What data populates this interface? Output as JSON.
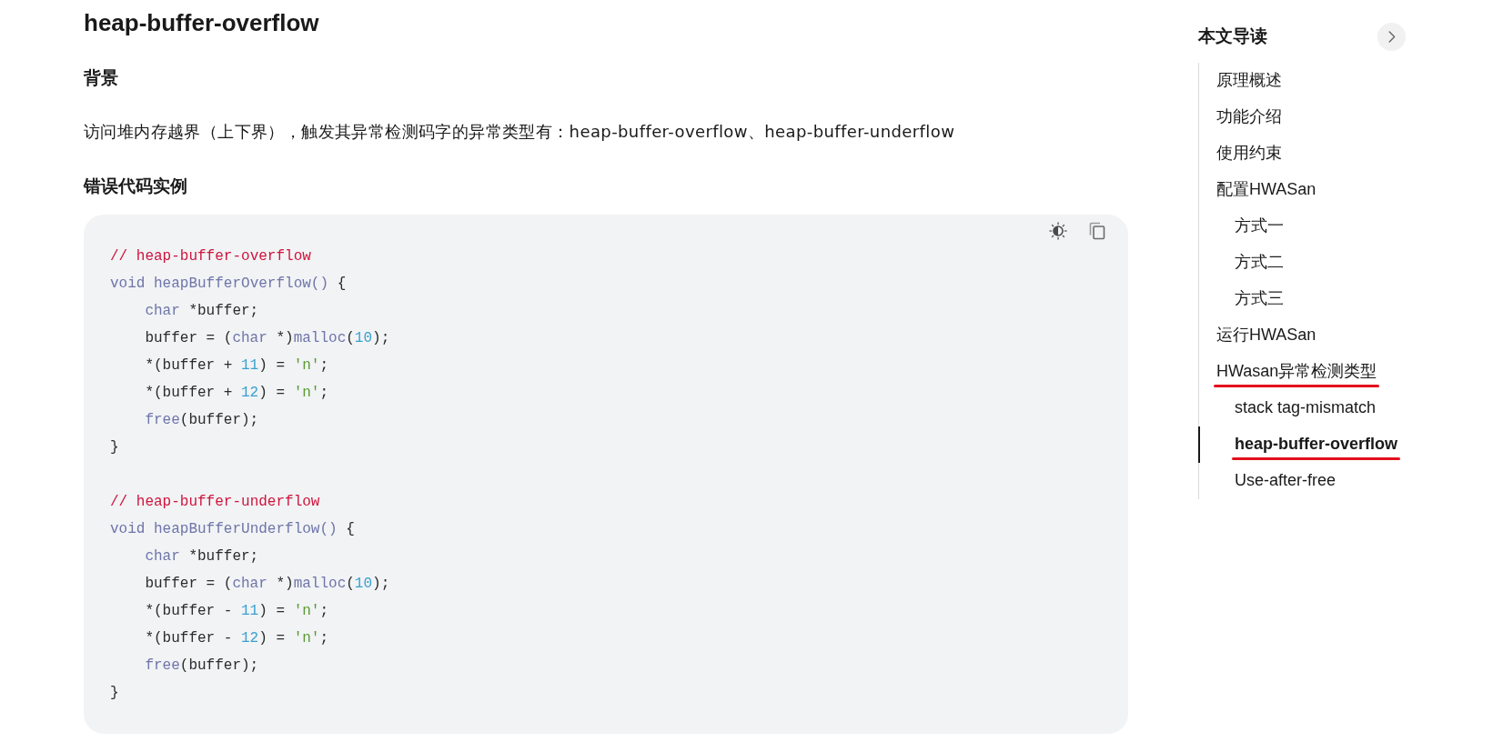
{
  "article": {
    "title": "heap-buffer-overflow",
    "background_heading": "背景",
    "background_text": "访问堆内存越界（上下界），触发其异常检测码字的异常类型有：heap-buffer-overflow、heap-buffer-underflow",
    "example_heading": "错误代码实例"
  },
  "code": {
    "snippets": [
      {
        "lines": [
          {
            "indented": false,
            "tokens": [
              {
                "kind": "comment",
                "text": "// heap-buffer-overflow"
              }
            ]
          },
          {
            "indented": false,
            "tokens": [
              {
                "kind": "keyword",
                "text": "void heapBufferOverflow()"
              },
              {
                "kind": "plain",
                "text": " {"
              }
            ]
          },
          {
            "indented": true,
            "tokens": [
              {
                "kind": "keyword",
                "text": "char"
              },
              {
                "kind": "plain",
                "text": " *buffer;"
              }
            ]
          },
          {
            "indented": true,
            "tokens": [
              {
                "kind": "plain",
                "text": "buffer = ("
              },
              {
                "kind": "keyword",
                "text": "char"
              },
              {
                "kind": "plain",
                "text": " *)"
              },
              {
                "kind": "keyword",
                "text": "malloc"
              },
              {
                "kind": "plain",
                "text": "("
              },
              {
                "kind": "number",
                "text": "10"
              },
              {
                "kind": "plain",
                "text": ");"
              }
            ]
          },
          {
            "indented": true,
            "tokens": [
              {
                "kind": "plain",
                "text": "*(buffer + "
              },
              {
                "kind": "number",
                "text": "11"
              },
              {
                "kind": "plain",
                "text": ") = "
              },
              {
                "kind": "string",
                "text": "'n'"
              },
              {
                "kind": "plain",
                "text": ";"
              }
            ]
          },
          {
            "indented": true,
            "tokens": [
              {
                "kind": "plain",
                "text": "*(buffer + "
              },
              {
                "kind": "number",
                "text": "12"
              },
              {
                "kind": "plain",
                "text": ") = "
              },
              {
                "kind": "string",
                "text": "'n'"
              },
              {
                "kind": "plain",
                "text": ";"
              }
            ]
          },
          {
            "indented": true,
            "tokens": [
              {
                "kind": "keyword",
                "text": "free"
              },
              {
                "kind": "plain",
                "text": "(buffer);"
              }
            ]
          },
          {
            "indented": false,
            "tokens": [
              {
                "kind": "plain",
                "text": "}"
              }
            ]
          }
        ]
      },
      {
        "lines": [
          {
            "indented": false,
            "tokens": [
              {
                "kind": "comment",
                "text": "// heap-buffer-underflow"
              }
            ]
          },
          {
            "indented": false,
            "tokens": [
              {
                "kind": "keyword",
                "text": "void heapBufferUnderflow()"
              },
              {
                "kind": "plain",
                "text": " {"
              }
            ]
          },
          {
            "indented": true,
            "tokens": [
              {
                "kind": "keyword",
                "text": "char"
              },
              {
                "kind": "plain",
                "text": " *buffer;"
              }
            ]
          },
          {
            "indented": true,
            "tokens": [
              {
                "kind": "plain",
                "text": "buffer = ("
              },
              {
                "kind": "keyword",
                "text": "char"
              },
              {
                "kind": "plain",
                "text": " *)"
              },
              {
                "kind": "keyword",
                "text": "malloc"
              },
              {
                "kind": "plain",
                "text": "("
              },
              {
                "kind": "number",
                "text": "10"
              },
              {
                "kind": "plain",
                "text": ");"
              }
            ]
          },
          {
            "indented": true,
            "tokens": [
              {
                "kind": "plain",
                "text": "*(buffer - "
              },
              {
                "kind": "number",
                "text": "11"
              },
              {
                "kind": "plain",
                "text": ") = "
              },
              {
                "kind": "string",
                "text": "'n'"
              },
              {
                "kind": "plain",
                "text": ";"
              }
            ]
          },
          {
            "indented": true,
            "tokens": [
              {
                "kind": "plain",
                "text": "*(buffer - "
              },
              {
                "kind": "number",
                "text": "12"
              },
              {
                "kind": "plain",
                "text": ") = "
              },
              {
                "kind": "string",
                "text": "'n'"
              },
              {
                "kind": "plain",
                "text": ";"
              }
            ]
          },
          {
            "indented": true,
            "tokens": [
              {
                "kind": "keyword",
                "text": "free"
              },
              {
                "kind": "plain",
                "text": "(buffer);"
              }
            ]
          },
          {
            "indented": false,
            "tokens": [
              {
                "kind": "plain",
                "text": "}"
              }
            ]
          }
        ]
      }
    ]
  },
  "toc": {
    "title": "本文导读",
    "items": [
      {
        "label": "原理概述",
        "selected": false,
        "underlined": false
      },
      {
        "label": "功能介绍",
        "selected": false,
        "underlined": false
      },
      {
        "label": "使用约束",
        "selected": false,
        "underlined": false
      },
      {
        "label": "配置HWASan",
        "selected": false,
        "underlined": false,
        "children": [
          {
            "label": "方式一",
            "selected": false,
            "underlined": false
          },
          {
            "label": "方式二",
            "selected": false,
            "underlined": false
          },
          {
            "label": "方式三",
            "selected": false,
            "underlined": false
          }
        ]
      },
      {
        "label": "运行HWASan",
        "selected": false,
        "underlined": false
      },
      {
        "label": "HWasan异常检测类型",
        "selected": false,
        "underlined": true,
        "children": [
          {
            "label": "stack tag-mismatch",
            "selected": false,
            "underlined": false
          },
          {
            "label": "heap-buffer-overflow",
            "selected": true,
            "underlined": true
          },
          {
            "label": "Use-after-free",
            "selected": false,
            "underlined": false
          }
        ]
      }
    ]
  }
}
